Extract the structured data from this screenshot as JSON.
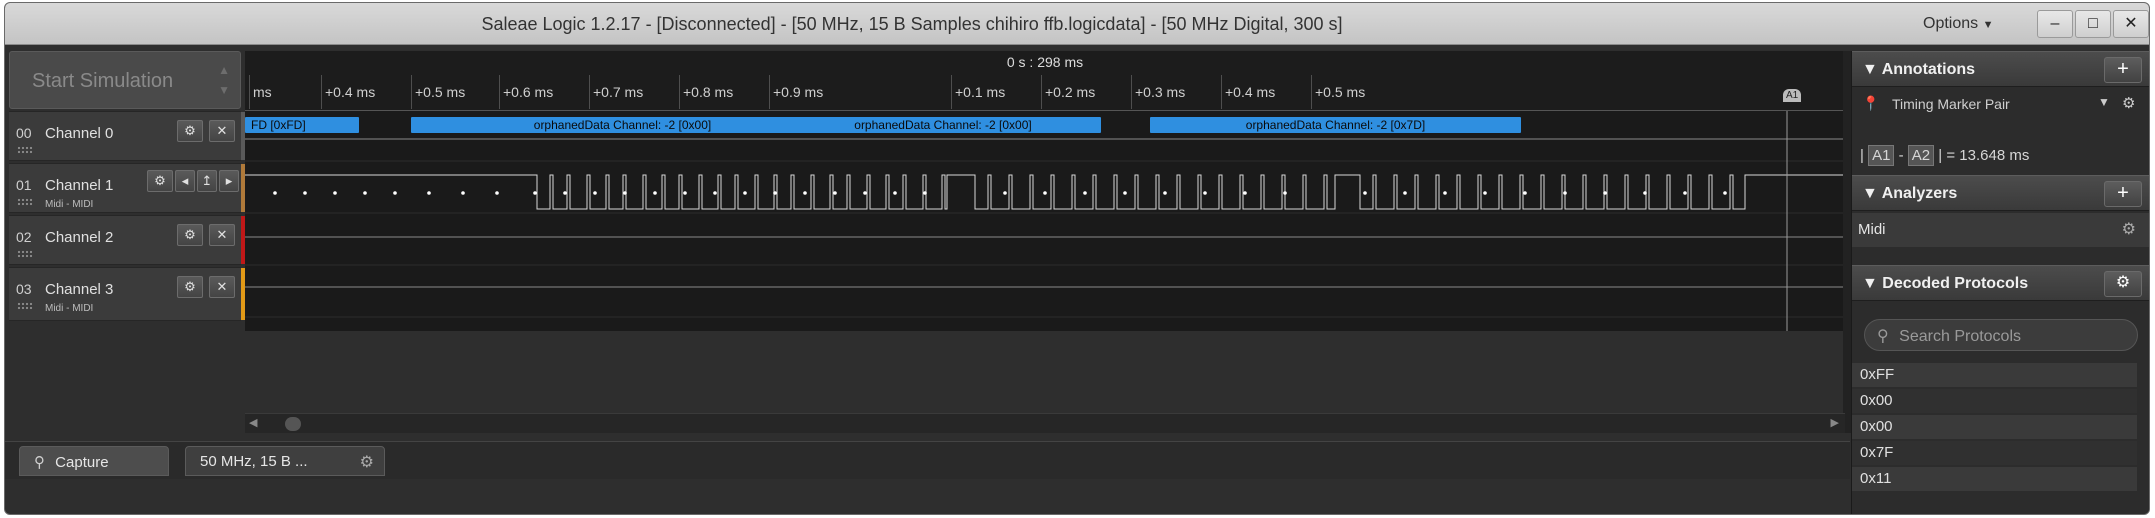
{
  "window": {
    "title": "Saleae Logic 1.2.17 - [Disconnected] - [50 MHz, 15 B Samples chihiro ffb.logicdata] - [50 MHz Digital, 300 s]",
    "options_label": "Options",
    "minimize": "–",
    "maximize": "□",
    "close": "✕"
  },
  "sim": {
    "label": "Start Simulation"
  },
  "ruler": {
    "center_label": "0 s : 298 ms",
    "ticks": [
      "ms",
      "+0.4 ms",
      "+0.5 ms",
      "+0.6 ms",
      "+0.7 ms",
      "+0.8 ms",
      "+0.9 ms",
      "+0.1 ms",
      "+0.2 ms",
      "+0.3 ms",
      "+0.4 ms",
      "+0.5 ms"
    ]
  },
  "channels": [
    {
      "num": "00",
      "name": "Channel 0",
      "analyzer": "",
      "color": "#5a5a5a"
    },
    {
      "num": "01",
      "name": "Channel 1",
      "analyzer": "Midi - MIDI",
      "color": "#b07a3a"
    },
    {
      "num": "02",
      "name": "Channel 2",
      "analyzer": "",
      "color": "#c01818"
    },
    {
      "num": "03",
      "name": "Channel 3",
      "analyzer": "Midi - MIDI",
      "color": "#e29a17"
    }
  ],
  "decode_bubbles": [
    {
      "text": "FD  [0xFD]"
    },
    {
      "text": "orphanedData Channel: -2 [0x00]"
    },
    {
      "text": "orphanedData Channel: -2 [0x00]"
    },
    {
      "text": "orphanedData Channel: -2 [0x7D]"
    }
  ],
  "marker": {
    "label": "A1"
  },
  "tabs": [
    {
      "label": "Capture",
      "icon": "search-icon"
    },
    {
      "label": "50 MHz, 15 B ...",
      "icon": "gear-icon"
    }
  ],
  "annotations": {
    "title": "Annotations",
    "add": "+",
    "marker_pair": "Timing Marker Pair",
    "a1": "A1",
    "dash": "-",
    "a2": "A2",
    "measurement": "= 13.648 ms"
  },
  "analyzers": {
    "title": "Analyzers",
    "add": "+",
    "items": [
      "Midi"
    ]
  },
  "decoded": {
    "title": "Decoded Protocols",
    "search_placeholder": "Search Protocols",
    "items": [
      "0xFF",
      "0x00",
      "0x00",
      "0x7F",
      "0x11"
    ]
  },
  "colors": {
    "decode_bubble": "#2f8fe0",
    "signal": "#d8d8d8",
    "accent": "#e8e8e8"
  }
}
